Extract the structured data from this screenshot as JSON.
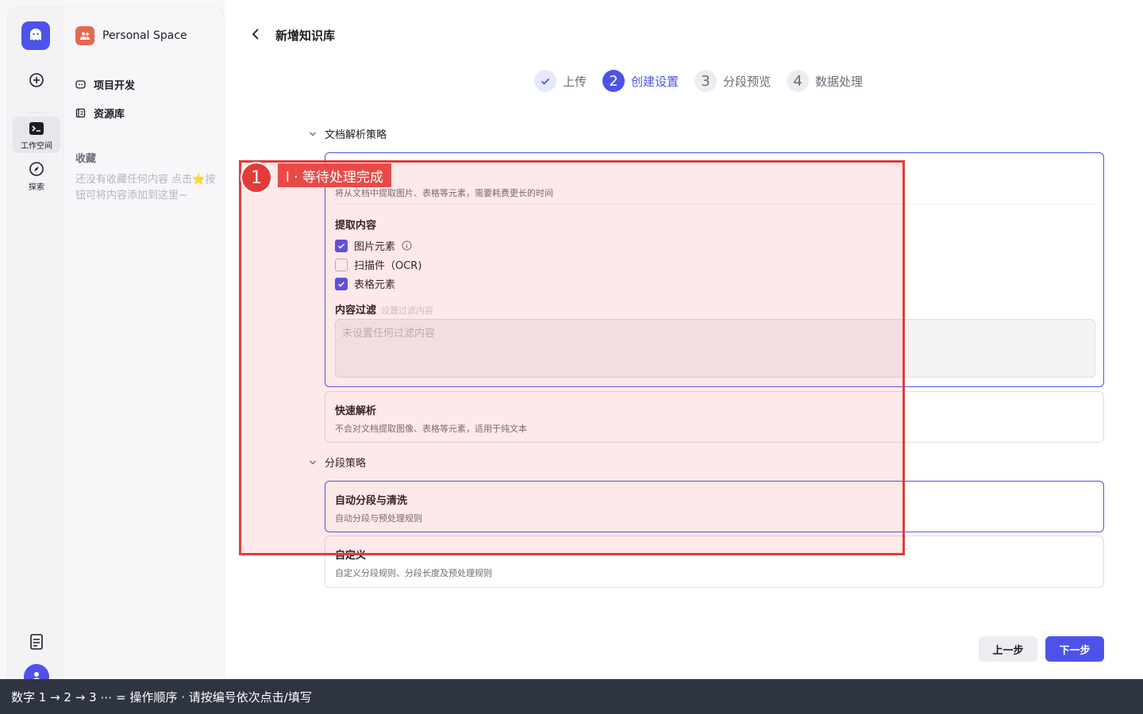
{
  "sidebar_rail": {
    "items": [
      {
        "label": ""
      },
      {
        "label": "工作空间"
      },
      {
        "label": "探索"
      }
    ]
  },
  "space": {
    "name": "Personal Space"
  },
  "nav": {
    "items": [
      {
        "label": "项目开发"
      },
      {
        "label": "资源库"
      }
    ]
  },
  "favorites": {
    "title": "收藏",
    "empty_text": "还没有收藏任何内容 点击⭐按钮可将内容添加到这里~"
  },
  "header": {
    "title": "新增知识库"
  },
  "steps": [
    {
      "num": "✓",
      "label": "上传",
      "state": "done"
    },
    {
      "num": "2",
      "label": "创建设置",
      "state": "active"
    },
    {
      "num": "3",
      "label": "分段预览",
      "state": "todo"
    },
    {
      "num": "4",
      "label": "数据处理",
      "state": "todo"
    }
  ],
  "parse": {
    "section_title": "文档解析策略",
    "precise": {
      "desc": "将从文档中提取图片、表格等元素，需要耗费更长的时间",
      "extract_title": "提取内容",
      "options": [
        {
          "label": "图片元素",
          "checked": true
        },
        {
          "label": "扫描件（OCR)",
          "checked": false
        },
        {
          "label": "表格元素",
          "checked": true
        }
      ],
      "filter_title": "内容过滤",
      "filter_hint": "设置过滤内容",
      "filter_placeholder": "未设置任何过滤内容"
    },
    "quick": {
      "title": "快速解析",
      "desc": "不会对文档提取图像、表格等元素，适用于纯文本"
    }
  },
  "segment": {
    "section_title": "分段策略",
    "auto": {
      "title": "自动分段与清洗",
      "desc": "自动分段与预处理规则"
    },
    "custom": {
      "title": "自定义",
      "desc": "自定义分段规则、分段长度及预处理规则"
    }
  },
  "buttons": {
    "prev": "上一步",
    "next": "下一步"
  },
  "annotation": {
    "number": "1",
    "label": "l · 等待处理完成"
  },
  "bottom_bar": {
    "text": "数字 1 → 2 → 3 ⋯ = 操作顺序 · 请按编号依次点击/填写"
  },
  "colors": {
    "accent": "#4d53e8",
    "annotation": "#e23b3b"
  }
}
